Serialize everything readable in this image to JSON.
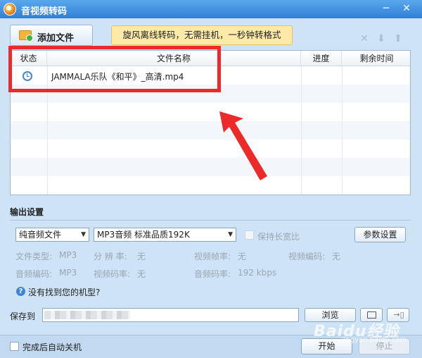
{
  "window": {
    "title": "音视频转码"
  },
  "toolbar": {
    "add_file_label": "添加文件",
    "promo_text": "旋风离线转码，无需挂机，一秒钟转格式"
  },
  "table": {
    "columns": [
      "状态",
      "文件名称",
      "进度",
      "剩余时间"
    ],
    "rows": [
      {
        "status_icon": "clock-icon",
        "filename": "JAMMALA乐队《和平》_高清.mp4",
        "progress": "",
        "remaining": ""
      }
    ]
  },
  "output": {
    "title": "输出设置",
    "format_category": "纯音频文件",
    "format_preset": "MP3音频 标准品质192K",
    "keep_ratio_label": "保持长宽比",
    "param_button": "参数设置",
    "info": {
      "file_type_label": "文件类型:",
      "file_type_value": "MP3",
      "resolution_label": "分 辨 率:",
      "resolution_value": "无",
      "video_fps_label": "视频帧率:",
      "video_fps_value": "无",
      "video_codec_label": "视频编码:",
      "video_codec_value": "无",
      "audio_codec_label": "音频编码:",
      "audio_codec_value": "MP3",
      "video_bitrate_label": "视频码率:",
      "video_bitrate_value": "无",
      "audio_bitrate_label": "音频码率:",
      "audio_bitrate_value": "192 kbps"
    },
    "help_link": "没有找到您的机型?"
  },
  "save": {
    "label": "保存到",
    "browse_button": "浏览"
  },
  "footer": {
    "auto_shutdown_label": "完成后自动关机",
    "start_button": "开始",
    "stop_button": "停止"
  },
  "watermark": {
    "text": "Baidu经验",
    "sub": "jingyan.baidu.com"
  },
  "colors": {
    "title_bar": "#2f7fd6",
    "highlight": "#ec2a2a",
    "promo_bg": "#fde9a8",
    "window_bg": "#cfe3f6"
  }
}
